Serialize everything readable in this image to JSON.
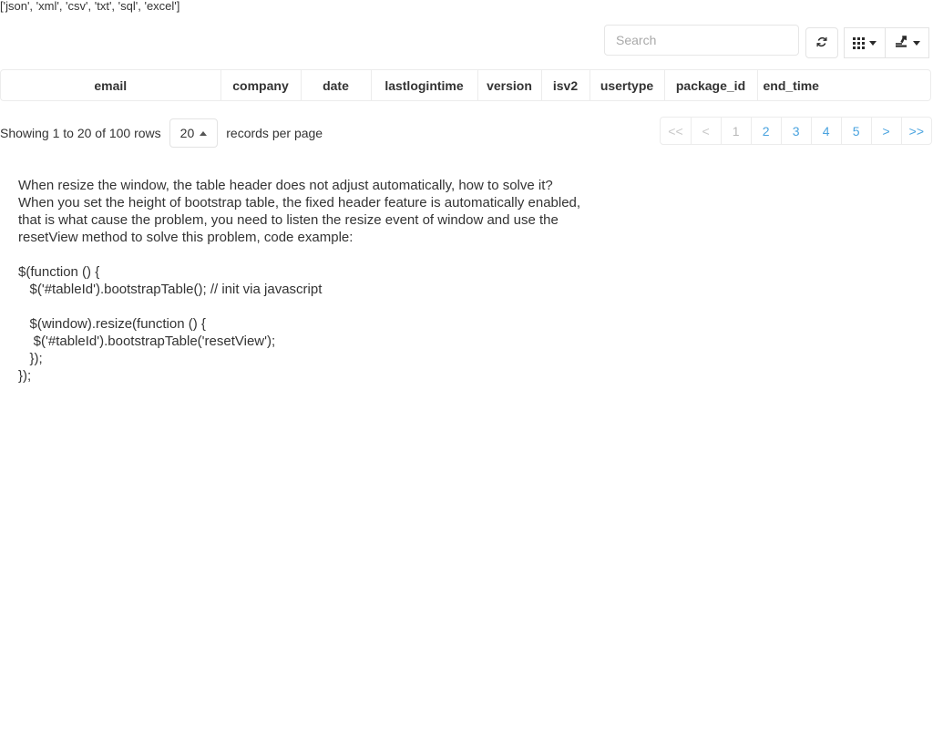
{
  "top_note": "['json', 'xml', 'csv', 'txt', 'sql', 'excel']",
  "toolbar": {
    "search": {
      "placeholder": "Search",
      "value": ""
    },
    "refresh_icon": "refresh-icon",
    "columns_icon": "grid-icon",
    "export_icon": "export-icon"
  },
  "table": {
    "columns": [
      {
        "label": "email"
      },
      {
        "label": "company"
      },
      {
        "label": "date"
      },
      {
        "label": "lastlogintime"
      },
      {
        "label": "version"
      },
      {
        "label": "isv2"
      },
      {
        "label": "usertype"
      },
      {
        "label": "package_id"
      },
      {
        "label": "end_time"
      }
    ]
  },
  "pagination": {
    "summary": "Showing 1 to 20 of 100 rows",
    "page_size": "20",
    "records_per_page_label": "records per page",
    "buttons": [
      {
        "label": "<<",
        "state": "muted"
      },
      {
        "label": "<",
        "state": "muted"
      },
      {
        "label": "1",
        "state": "active"
      },
      {
        "label": "2",
        "state": "link"
      },
      {
        "label": "3",
        "state": "link"
      },
      {
        "label": "4",
        "state": "link"
      },
      {
        "label": "5",
        "state": "link"
      },
      {
        "label": ">",
        "state": "link"
      },
      {
        "label": ">>",
        "state": "link"
      }
    ]
  },
  "article": {
    "paragraph_lines": [
      "When resize the window, the table header does not adjust automatically, how to solve it?",
      "When you set the height of bootstrap table, the fixed header feature is automatically enabled,",
      "that is what cause the problem, you need to listen the resize event of window and use the",
      "resetView method to solve this problem, code example:"
    ],
    "code": "$(function () {\n   $('#tableId').bootstrapTable(); // init via javascript\n\n   $(window).resize(function () {\n    $('#tableId').bootstrapTable('resetView');\n   });\n});"
  },
  "colors": {
    "link": "#4aa3df",
    "text": "#333333",
    "border": "#ececec",
    "muted": "#c8c8c8"
  }
}
